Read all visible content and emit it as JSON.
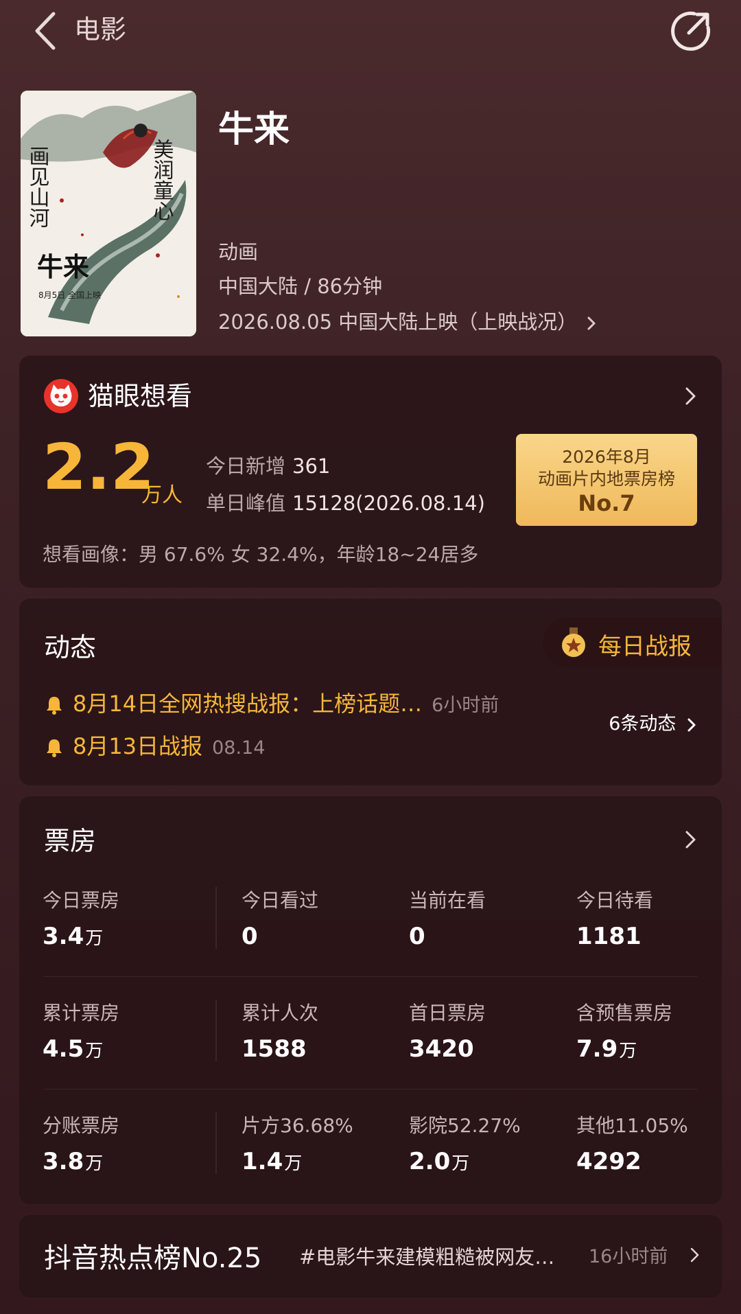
{
  "topbar": {
    "title": "电影"
  },
  "movie": {
    "title": "牛来",
    "genre": "动画",
    "region_duration": "中国大陆 / 86分钟",
    "release": "2026.08.05 中国大陆上映（上映战况）",
    "poster": {
      "left_text": "画见山河",
      "right_text": "美润童心",
      "title": "牛来",
      "date_line": "8月5日 全国上映"
    }
  },
  "want": {
    "title": "猫眼想看",
    "big_number": "2.2",
    "unit": "万人",
    "today_label": "今日新增",
    "today_value": "361",
    "peak_label": "单日峰值",
    "peak_value": "15128(2026.08.14)",
    "rank_line1": "2026年8月",
    "rank_line2": "动画片内地票房榜",
    "rank_no": "No.7",
    "profile": "想看画像：男 67.6%  女 32.4%，年龄18~24居多"
  },
  "news": {
    "title": "动态",
    "daily_report": "每日战报",
    "items": [
      {
        "text": "8月14日全网热搜战报：上榜话题…",
        "time": "6小时前"
      },
      {
        "text": "8月13日战报",
        "time": "08.14"
      }
    ],
    "count": "6条动态"
  },
  "box": {
    "title": "票房",
    "rows": [
      [
        {
          "label": "今日票房",
          "value": "3.4",
          "unit": "万"
        },
        {
          "label": "今日看过",
          "value": "0",
          "unit": ""
        },
        {
          "label": "当前在看",
          "value": "0",
          "unit": ""
        },
        {
          "label": "今日待看",
          "value": "1181",
          "unit": ""
        }
      ],
      [
        {
          "label": "累计票房",
          "value": "4.5",
          "unit": "万"
        },
        {
          "label": "累计人次",
          "value": "1588",
          "unit": ""
        },
        {
          "label": "首日票房",
          "value": "3420",
          "unit": ""
        },
        {
          "label": "含预售票房",
          "value": "7.9",
          "unit": "万"
        }
      ],
      [
        {
          "label": "分账票房",
          "value": "3.8",
          "unit": "万"
        },
        {
          "label": "片方36.68%",
          "value": "1.4",
          "unit": "万"
        },
        {
          "label": "影院52.27%",
          "value": "2.0",
          "unit": "万"
        },
        {
          "label": "其他11.05%",
          "value": "4292",
          "unit": ""
        }
      ]
    ]
  },
  "douyin": {
    "title": "抖音热点榜No.25",
    "topic": "#电影牛来建模粗糙被网友…",
    "time": "16小时前"
  },
  "colors": {
    "accent": "#f7b63a",
    "background": "#3d2226",
    "card": "#26121 5"
  }
}
